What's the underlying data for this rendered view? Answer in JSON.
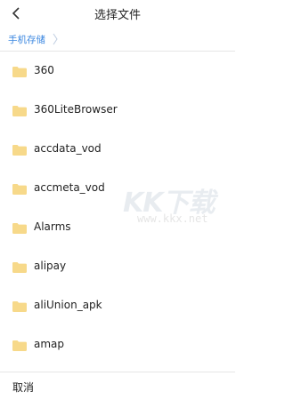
{
  "header": {
    "title": "选择文件",
    "back_icon": "chevron-left-icon"
  },
  "breadcrumb": {
    "current": "手机存储",
    "separator_icon": "chevron-right-icon",
    "accent": "#3b87e0"
  },
  "folders": [
    {
      "name": "360"
    },
    {
      "name": "360LiteBrowser"
    },
    {
      "name": "accdata_vod"
    },
    {
      "name": "accmeta_vod"
    },
    {
      "name": "Alarms"
    },
    {
      "name": "alipay"
    },
    {
      "name": "aliUnion_apk"
    },
    {
      "name": "amap"
    }
  ],
  "folder_icon": {
    "name": "folder-icon",
    "color": "#f7d98a"
  },
  "watermark": {
    "logo": "KK下载",
    "url": "www.kkx.net"
  },
  "footer": {
    "cancel_label": "取消"
  }
}
